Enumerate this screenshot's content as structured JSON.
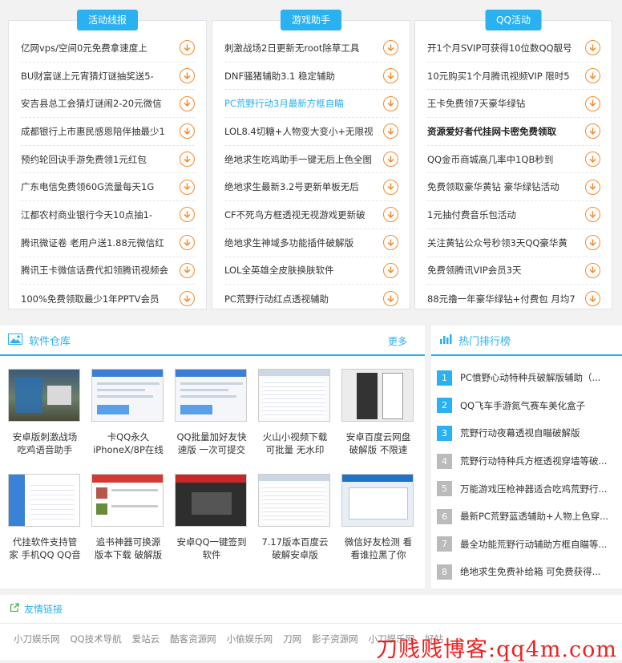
{
  "columns": [
    {
      "title": "活动线报",
      "items": [
        {
          "text": "亿网vps/空间0元免费拿速度上",
          "style": ""
        },
        {
          "text": "BU财富谜上元宵猜灯谜抽奖送5-",
          "style": ""
        },
        {
          "text": "安吉县总工会猜灯谜闹2-20元微信",
          "style": ""
        },
        {
          "text": "成都银行上市惠民感恩陪伴抽最少1",
          "style": ""
        },
        {
          "text": "预约轮回诀手游免费领1元红包",
          "style": ""
        },
        {
          "text": "广东电信免费领60G流量每天1G",
          "style": ""
        },
        {
          "text": "江都农村商业银行今天10点抽1-",
          "style": ""
        },
        {
          "text": "腾讯微证卷 老用户送1.88元微信红",
          "style": ""
        },
        {
          "text": "腾讯王卡微信话费代扣领腾讯视频会",
          "style": ""
        },
        {
          "text": "100%免费领取最少1年PPTV会员",
          "style": ""
        }
      ]
    },
    {
      "title": "游戏助手",
      "items": [
        {
          "text": "刺激战场2日更新无root除草工具",
          "style": ""
        },
        {
          "text": "DNF骚猪辅助3.1 稳定辅助",
          "style": ""
        },
        {
          "text": "PC荒野行动3月最新方框自瞄",
          "style": "blue"
        },
        {
          "text": "LOL8.4切糖+人物变大变小+无限视",
          "style": ""
        },
        {
          "text": "绝地求生吃鸡助手一键无后上色全图",
          "style": ""
        },
        {
          "text": "绝地求生最新3.2号更新单板无后",
          "style": ""
        },
        {
          "text": "CF不死鸟方框透视无视游戏更新破",
          "style": ""
        },
        {
          "text": "绝地求生神域多功能插件破解版",
          "style": ""
        },
        {
          "text": "LOL全英雄全皮肤换肤软件",
          "style": ""
        },
        {
          "text": "PC荒野行动红点透视辅助",
          "style": ""
        }
      ]
    },
    {
      "title": "QQ活动",
      "items": [
        {
          "text": "开1个月SVIP可获得10位数QQ靓号",
          "style": ""
        },
        {
          "text": "10元购买1个月腾讯视频VIP 限时5",
          "style": ""
        },
        {
          "text": "王卡免费领7天豪华绿钻",
          "style": ""
        },
        {
          "text": "资源爱好者代挂网卡密免费领取",
          "style": "bold"
        },
        {
          "text": "QQ金币商城高几率中1QB秒到",
          "style": ""
        },
        {
          "text": "免费领取豪华黄钻 豪华绿钻活动",
          "style": ""
        },
        {
          "text": "1元抽付费音乐包活动",
          "style": ""
        },
        {
          "text": "关注黄钻公众号秒领3天QQ豪华黄",
          "style": ""
        },
        {
          "text": "免费领腾讯VIP会员3天",
          "style": ""
        },
        {
          "text": "88元撸一年豪华绿钻+付费包 月均7",
          "style": ""
        }
      ]
    }
  ],
  "software": {
    "title": "软件仓库",
    "more": "更多",
    "cards": [
      {
        "line1": "安卓版刺激战场",
        "line2": "吃鸡语音助手",
        "thumb": "game"
      },
      {
        "line1": "卡QQ永久",
        "line2": "iPhoneX/8P在线",
        "thumb": "window"
      },
      {
        "line1": "QQ批量加好友快",
        "line2": "速版 一次可提交",
        "thumb": "window"
      },
      {
        "line1": "火山小视频下载",
        "line2": "可批量 无水印",
        "thumb": "list"
      },
      {
        "line1": "安卓百度云网盘",
        "line2": "破解版 不限速",
        "thumb": "phone"
      },
      {
        "line1": "代挂软件支持管",
        "line2": "家 手机QQ QQ音",
        "thumb": "blue"
      },
      {
        "line1": "追书神器可换源",
        "line2": "版本下载 破解版",
        "thumb": "red"
      },
      {
        "line1": "安卓QQ一键签到",
        "line2": "软件",
        "thumb": "dark"
      },
      {
        "line1": "7.17版本百度云",
        "line2": "破解安卓版",
        "thumb": "list"
      },
      {
        "line1": "微信好友检测 看",
        "line2": "看谁拉黑了你",
        "thumb": "dialog"
      }
    ]
  },
  "hot": {
    "title": "热门排行榜",
    "items": [
      {
        "num": "1",
        "text": "PC憤野心动特种兵破解版辅助（..."
      },
      {
        "num": "2",
        "text": "QQ飞车手游氮气赛车美化盒子"
      },
      {
        "num": "3",
        "text": "荒野行动夜幕透视自瞄破解版"
      },
      {
        "num": "4",
        "text": "荒野行动特种兵方框透视穿墙等破..."
      },
      {
        "num": "5",
        "text": "万能游戏压枪神器适合吃鸡荒野行..."
      },
      {
        "num": "6",
        "text": "最新PC荒野蓝透辅助+人物上色穿..."
      },
      {
        "num": "7",
        "text": "最全功能荒野行动辅助方框自瞄等..."
      },
      {
        "num": "8",
        "text": "绝地求生免费补给箱 可免费获得..."
      }
    ]
  },
  "links": {
    "title": "友情链接",
    "items": [
      "小刀娱乐网",
      "QQ技术导航",
      "爱站云",
      "酷客资源网",
      "小偷娱乐网",
      "刀网",
      "影子资源网",
      "小刀娱乐网",
      "好站"
    ]
  },
  "watermark": "刀贱贱博客:qq4m.com",
  "colors": {
    "accent": "#29b1f1",
    "download": "#f58a2c"
  }
}
